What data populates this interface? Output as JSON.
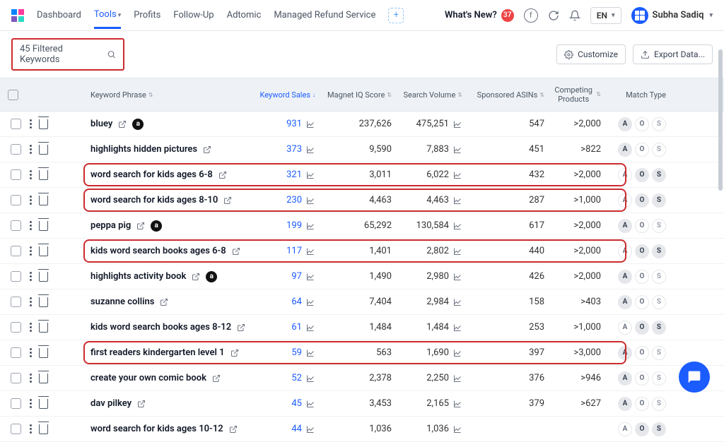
{
  "nav": {
    "items": [
      "Dashboard",
      "Tools",
      "Profits",
      "Follow-Up",
      "Adtomic",
      "Managed Refund Service"
    ],
    "active_index": 1
  },
  "topright": {
    "whatsnew": "What's New?",
    "whatsnew_count": "37",
    "lang": "EN",
    "user": "Subha Sadiq"
  },
  "toolbar": {
    "filter_label": "45 Filtered Keywords",
    "customize": "Customize",
    "export": "Export Data..."
  },
  "columns": {
    "phrase": "Keyword Phrase",
    "sales": "Keyword Sales",
    "iq": "Magnet IQ Score",
    "vol": "Search Volume",
    "asin": "Sponsored ASINs",
    "comp": "Competing Products",
    "match": "Match Type"
  },
  "rows": [
    {
      "phrase": "bluey",
      "badge": true,
      "sales": "931",
      "iq": "237,626",
      "vol": "475,251",
      "asin": "547",
      "comp": ">2,000",
      "pills": [
        "A"
      ],
      "hl": false
    },
    {
      "phrase": "highlights hidden pictures",
      "badge": false,
      "sales": "373",
      "iq": "9,590",
      "vol": "7,883",
      "asin": "451",
      "comp": ">822",
      "pills": [
        "A"
      ],
      "hl": false
    },
    {
      "phrase": "word search for kids ages 6-8",
      "badge": false,
      "sales": "321",
      "iq": "3,011",
      "vol": "6,022",
      "asin": "432",
      "comp": ">2,000",
      "pills": [
        "O",
        "S"
      ],
      "hl": true
    },
    {
      "phrase": "word search for kids ages 8-10",
      "badge": false,
      "sales": "230",
      "iq": "4,463",
      "vol": "4,463",
      "asin": "287",
      "comp": ">1,000",
      "pills": [
        "O",
        "S"
      ],
      "hl": true
    },
    {
      "phrase": "peppa pig",
      "badge": true,
      "sales": "199",
      "iq": "65,292",
      "vol": "130,584",
      "asin": "617",
      "comp": ">2,000",
      "pills": [
        "A"
      ],
      "hl": false
    },
    {
      "phrase": "kids word search books ages 6-8",
      "badge": false,
      "sales": "117",
      "iq": "1,401",
      "vol": "2,802",
      "asin": "440",
      "comp": ">2,000",
      "pills": [
        "O",
        "S"
      ],
      "hl": true
    },
    {
      "phrase": "highlights activity book",
      "badge": true,
      "sales": "97",
      "iq": "1,490",
      "vol": "2,980",
      "asin": "426",
      "comp": ">2,000",
      "pills": [
        "A"
      ],
      "hl": false
    },
    {
      "phrase": "suzanne collins",
      "badge": false,
      "sales": "64",
      "iq": "7,404",
      "vol": "2,984",
      "asin": "158",
      "comp": ">403",
      "pills": [
        "A"
      ],
      "hl": false
    },
    {
      "phrase": "kids word search books ages 8-12",
      "badge": false,
      "sales": "61",
      "iq": "1,484",
      "vol": "1,484",
      "asin": "253",
      "comp": ">1,000",
      "pills": [
        "O",
        "S"
      ],
      "hl": false
    },
    {
      "phrase": "first readers kindergarten level 1",
      "badge": false,
      "sales": "59",
      "iq": "563",
      "vol": "1,690",
      "asin": "397",
      "comp": ">3,000",
      "pills": [
        "A"
      ],
      "hl": true
    },
    {
      "phrase": "create your own comic book",
      "badge": false,
      "sales": "52",
      "iq": "2,378",
      "vol": "2,250",
      "asin": "376",
      "comp": ">946",
      "pills": [
        "A"
      ],
      "hl": false
    },
    {
      "phrase": "dav pilkey",
      "badge": false,
      "sales": "45",
      "iq": "3,453",
      "vol": "2,165",
      "asin": "379",
      "comp": ">627",
      "pills": [
        "A"
      ],
      "hl": false
    },
    {
      "phrase": "word search for kids ages 10-12",
      "badge": false,
      "sales": "44",
      "iq": "1,036",
      "vol": "1,036",
      "asin": "",
      "comp": "",
      "pills": [
        "O",
        "S"
      ],
      "hl": false
    }
  ]
}
